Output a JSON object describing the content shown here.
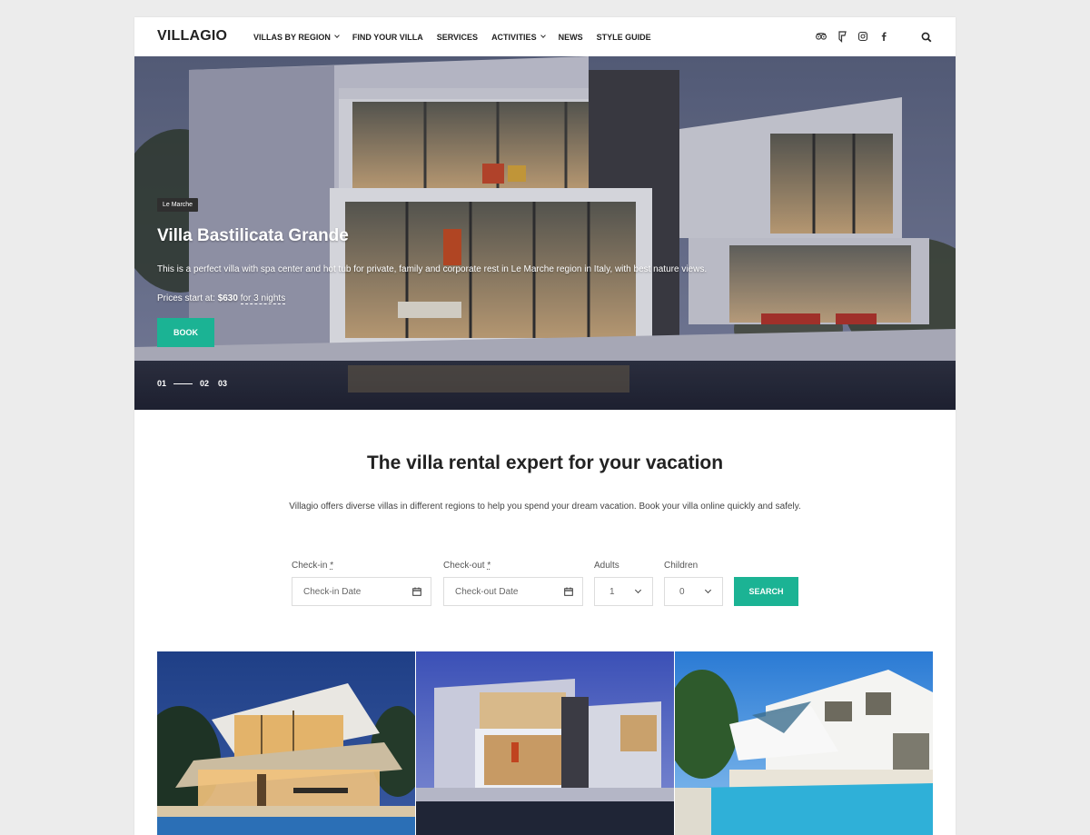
{
  "brand": {
    "logo_text": "VILLAGIO",
    "accent_color": "#1bb394"
  },
  "nav": {
    "items": [
      {
        "label": "VILLAS BY REGION",
        "has_dropdown": true
      },
      {
        "label": "FIND YOUR VILLA",
        "has_dropdown": false
      },
      {
        "label": "SERVICES",
        "has_dropdown": false
      },
      {
        "label": "ACTIVITIES",
        "has_dropdown": true
      },
      {
        "label": "NEWS",
        "has_dropdown": false
      },
      {
        "label": "STYLE GUIDE",
        "has_dropdown": false
      }
    ],
    "social_icons": [
      "tripadvisor-icon",
      "foursquare-icon",
      "instagram-icon",
      "facebook-icon"
    ],
    "search_icon": "search-icon"
  },
  "hero": {
    "tag": "Le Marche",
    "title": "Villa Bastilicata Grande",
    "description": "This is a perfect villa with spa center and hot tub for private, family and corporate rest in Le Marche region in Italy, with best nature views.",
    "price_prefix": "Prices start at: ",
    "price": "$630",
    "price_suffix": "for 3 nights",
    "book_label": "BOOK",
    "slides": [
      "01",
      "02",
      "03"
    ],
    "active_slide": "01"
  },
  "intro": {
    "title": "The villa rental expert for your vacation",
    "text": "Villagio offers diverse  villas in different regions to help you spend your dream vacation. Book your villa online quickly and safely."
  },
  "booking_form": {
    "checkin_label": "Check-in",
    "checkout_label": "Check-out",
    "required_mark": "*",
    "checkin_placeholder": "Check-in Date",
    "checkout_placeholder": "Check-out Date",
    "adults_label": "Adults",
    "adults_value": "1",
    "children_label": "Children",
    "children_value": "0",
    "search_label": "SEARCH"
  }
}
